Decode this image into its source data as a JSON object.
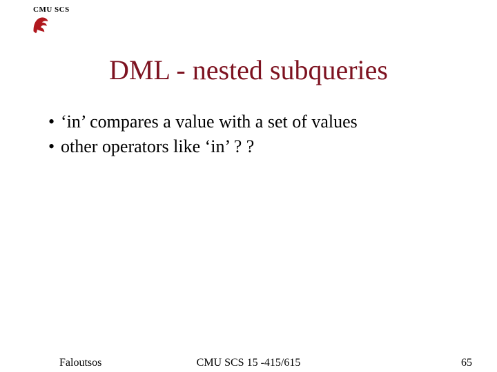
{
  "header": {
    "label": "CMU SCS"
  },
  "title": "DML - nested subqueries",
  "bullets": [
    "‘in’ compares a value with a set of values",
    "other operators like ‘in’ ? ?"
  ],
  "footer": {
    "left": "Faloutsos",
    "center": "CMU SCS 15 -415/615",
    "right": "65"
  }
}
